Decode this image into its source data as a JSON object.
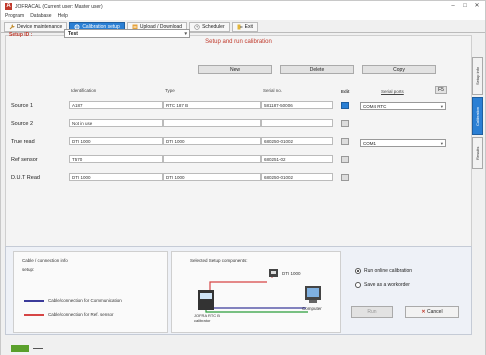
{
  "window": {
    "title": "JOFRACAL (Current user: Master user)",
    "controls": [
      "–",
      "□",
      "✕"
    ]
  },
  "menu": [
    "Program",
    "Database",
    "Help"
  ],
  "tabs": [
    {
      "label": "Device maintenance",
      "icon": "wrench-icon",
      "active": false
    },
    {
      "label": "Calibration setup",
      "icon": "gear-icon",
      "active": true
    },
    {
      "label": "Upload / Download",
      "icon": "transfer-icon",
      "active": false
    },
    {
      "label": "Scheduler",
      "icon": "clock-icon",
      "active": false
    },
    {
      "label": "Exit",
      "icon": "exit-icon",
      "active": false
    }
  ],
  "section_title": "Setup and run calibration",
  "setup": {
    "label": "Setup ID :",
    "value": "Test",
    "buttons": {
      "new": "New",
      "delete": "Delete",
      "copy": "Copy"
    }
  },
  "table": {
    "headers": {
      "identification": "Identification",
      "type": "Type",
      "serial": "Serial no.",
      "edit": "Edit",
      "serial_ports": "Serial ports",
      "refresh": "F5"
    },
    "rows": [
      {
        "label": "Source 1",
        "id": "A187",
        "type": "RTC 187 B",
        "serial": "581187-50006",
        "edit_active": true,
        "port": "COM4 RTC"
      },
      {
        "label": "Source 2",
        "id": "Not in use",
        "type": "",
        "serial": "",
        "edit_active": false,
        "port": ""
      },
      {
        "label": "True read",
        "id": "DTI 1000",
        "type": "DTI 1000",
        "serial": "680250-01002",
        "edit_active": false,
        "port": "COM1"
      },
      {
        "label": "Ref sensor",
        "id": "T570",
        "type": "",
        "serial": "680251-02",
        "edit_active": false,
        "port": ""
      },
      {
        "label": "D.U.T Read",
        "id": "DTI 1000",
        "type": "DTI 1000",
        "serial": "680250-01002",
        "edit_active": false,
        "port": ""
      }
    ]
  },
  "side_tabs": [
    "Setup info",
    "Calibration",
    "Results"
  ],
  "bottom": {
    "cable_title": "Cable / connection info",
    "setup_label": "setup:",
    "legend_comm": "Cable/connection for Communication",
    "legend_ref": "Cable/connection for Ref. sensor",
    "diagram_title": "Selected Setup components:",
    "device_label": "DTI 1000",
    "rtc_label": "JOFRA RTC B calibrator",
    "computer_label": "Computer",
    "radio_online": "Run online calibration",
    "radio_workorder": "Save as a workorder",
    "run_btn": "Run",
    "cancel_btn": "Cancel"
  },
  "colors": {
    "accent": "#2a7fd4",
    "title_red": "#c0392b",
    "comm_line": "#3b3b9a",
    "ref_line": "#d64545",
    "green_line": "#2a9d3a"
  }
}
